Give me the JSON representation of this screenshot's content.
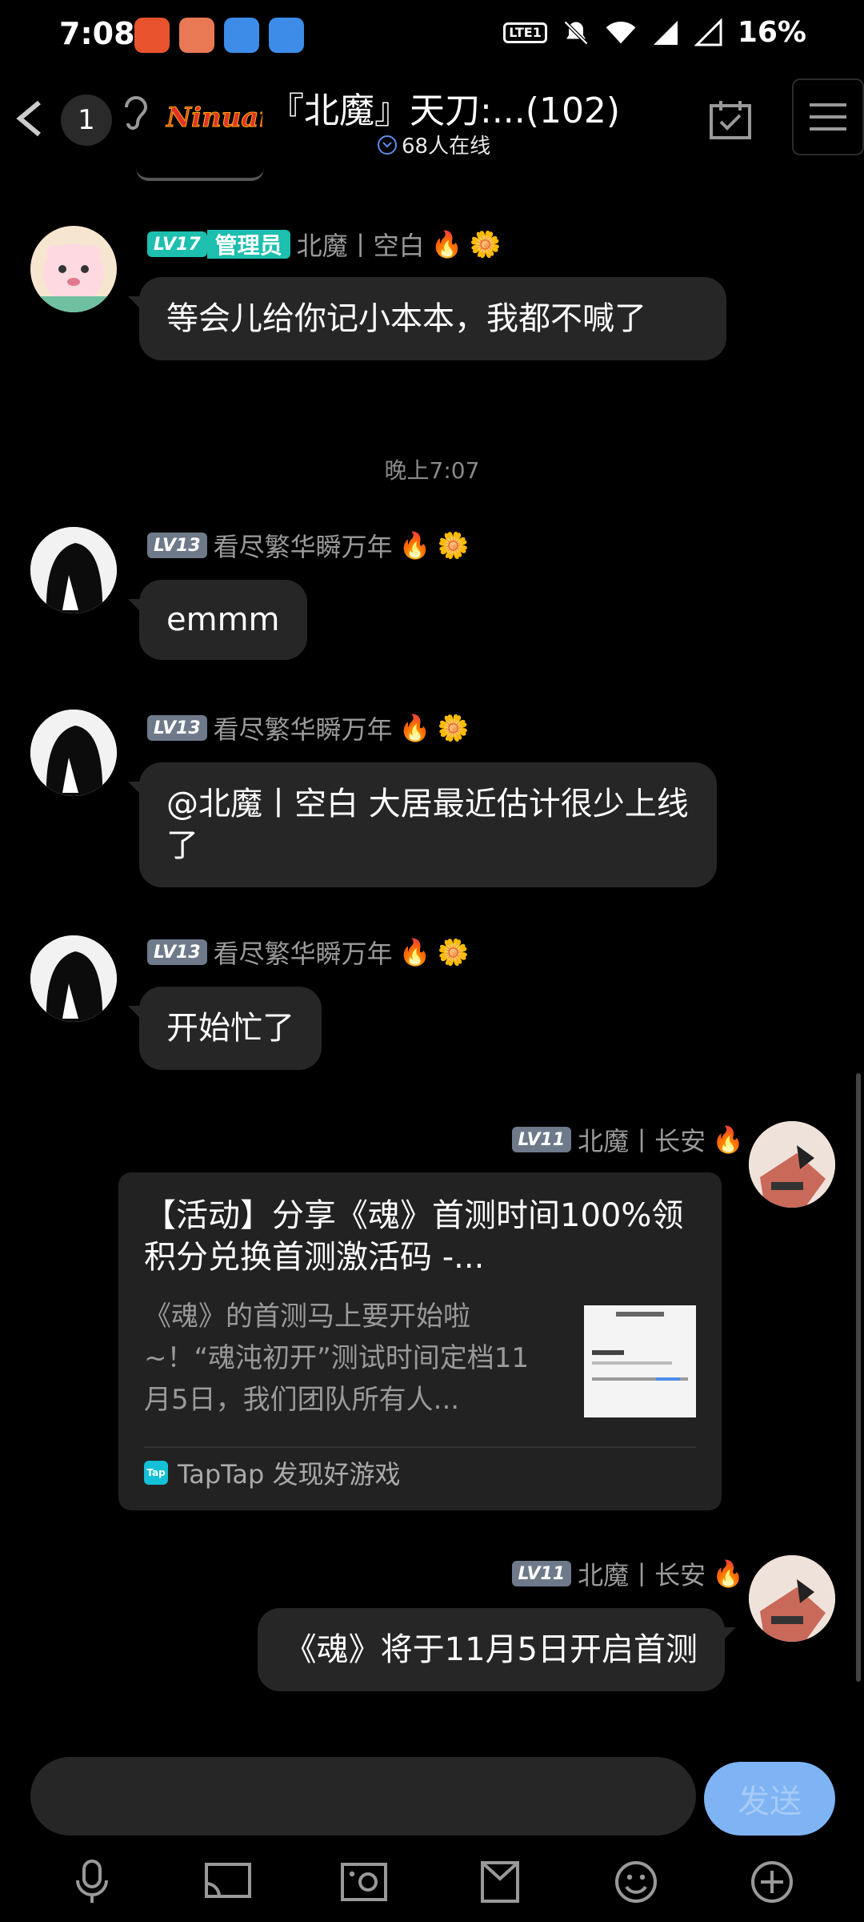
{
  "status_bar": {
    "time": "7:08",
    "volte": "LTE1",
    "network": "4G",
    "battery": "16%"
  },
  "header": {
    "unread_count": "1",
    "logo_text": "Ninuark",
    "title": "『北魔』天刀:...(102)",
    "online": "68人在线"
  },
  "messages": [
    {
      "level": "LV17",
      "role": "管理员",
      "sender": "北魔丨空白",
      "text": "等会儿给你记小本本，我都不喊了"
    },
    {
      "separator": "晚上7:07"
    },
    {
      "level": "LV13",
      "sender": "看尽繁华瞬万年",
      "text": "emmm"
    },
    {
      "level": "LV13",
      "sender": "看尽繁华瞬万年",
      "text": "@北魔丨空白 大居最近估计很少上线了"
    },
    {
      "level": "LV13",
      "sender": "看尽繁华瞬万年",
      "text": "开始忙了"
    },
    {
      "level": "LV11",
      "sender": "北魔丨长安",
      "card": {
        "title": "【活动】分享《魂》首测时间100%领积分兑换首测激活码 -...",
        "desc": "《魂》的首测马上要开始啦~！“魂沌初开”测试时间定档11月5日，我们团队所有人...",
        "source": "TapTap 发现好游戏",
        "source_logo": "Tap"
      }
    },
    {
      "level": "LV11",
      "sender": "北魔丨长安",
      "text": "《魂》将于11月5日开启首测"
    }
  ],
  "composer": {
    "placeholder": "",
    "send_label": "发送"
  },
  "colors": {
    "accent": "#7fb4f4",
    "admin": "#1dbfae",
    "bubble": "#262626",
    "background": "#000000"
  },
  "toolbar_icons": [
    "microphone-icon",
    "cast-icon",
    "photo-icon",
    "envelope-icon",
    "emoji-icon",
    "add-icon"
  ]
}
